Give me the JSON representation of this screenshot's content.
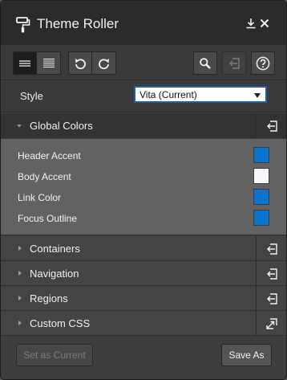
{
  "window": {
    "title": "Theme Roller"
  },
  "titlebar_icons": [
    "paint-roller-icon",
    "download-icon",
    "close-icon"
  ],
  "toolbar": {
    "left_group": [
      "list-view-icon",
      "detail-view-icon"
    ],
    "history_group": [
      "undo-icon",
      "redo-icon"
    ],
    "right": [
      "search-icon",
      "reset-icon",
      "help-icon"
    ]
  },
  "style": {
    "label": "Style",
    "selected": "Vita (Current)"
  },
  "sections": {
    "global_colors": "Global Colors",
    "containers": "Containers",
    "navigation": "Navigation",
    "regions": "Regions",
    "custom_css": "Custom CSS"
  },
  "colors": [
    {
      "label": "Header Accent",
      "value": "#0a74d0"
    },
    {
      "label": "Body Accent",
      "value": "#f5f7fa"
    },
    {
      "label": "Link Color",
      "value": "#0a74d0"
    },
    {
      "label": "Focus Outline",
      "value": "#0a74d0"
    }
  ],
  "footer": {
    "set_current": "Set as Current",
    "save_as": "Save As"
  }
}
